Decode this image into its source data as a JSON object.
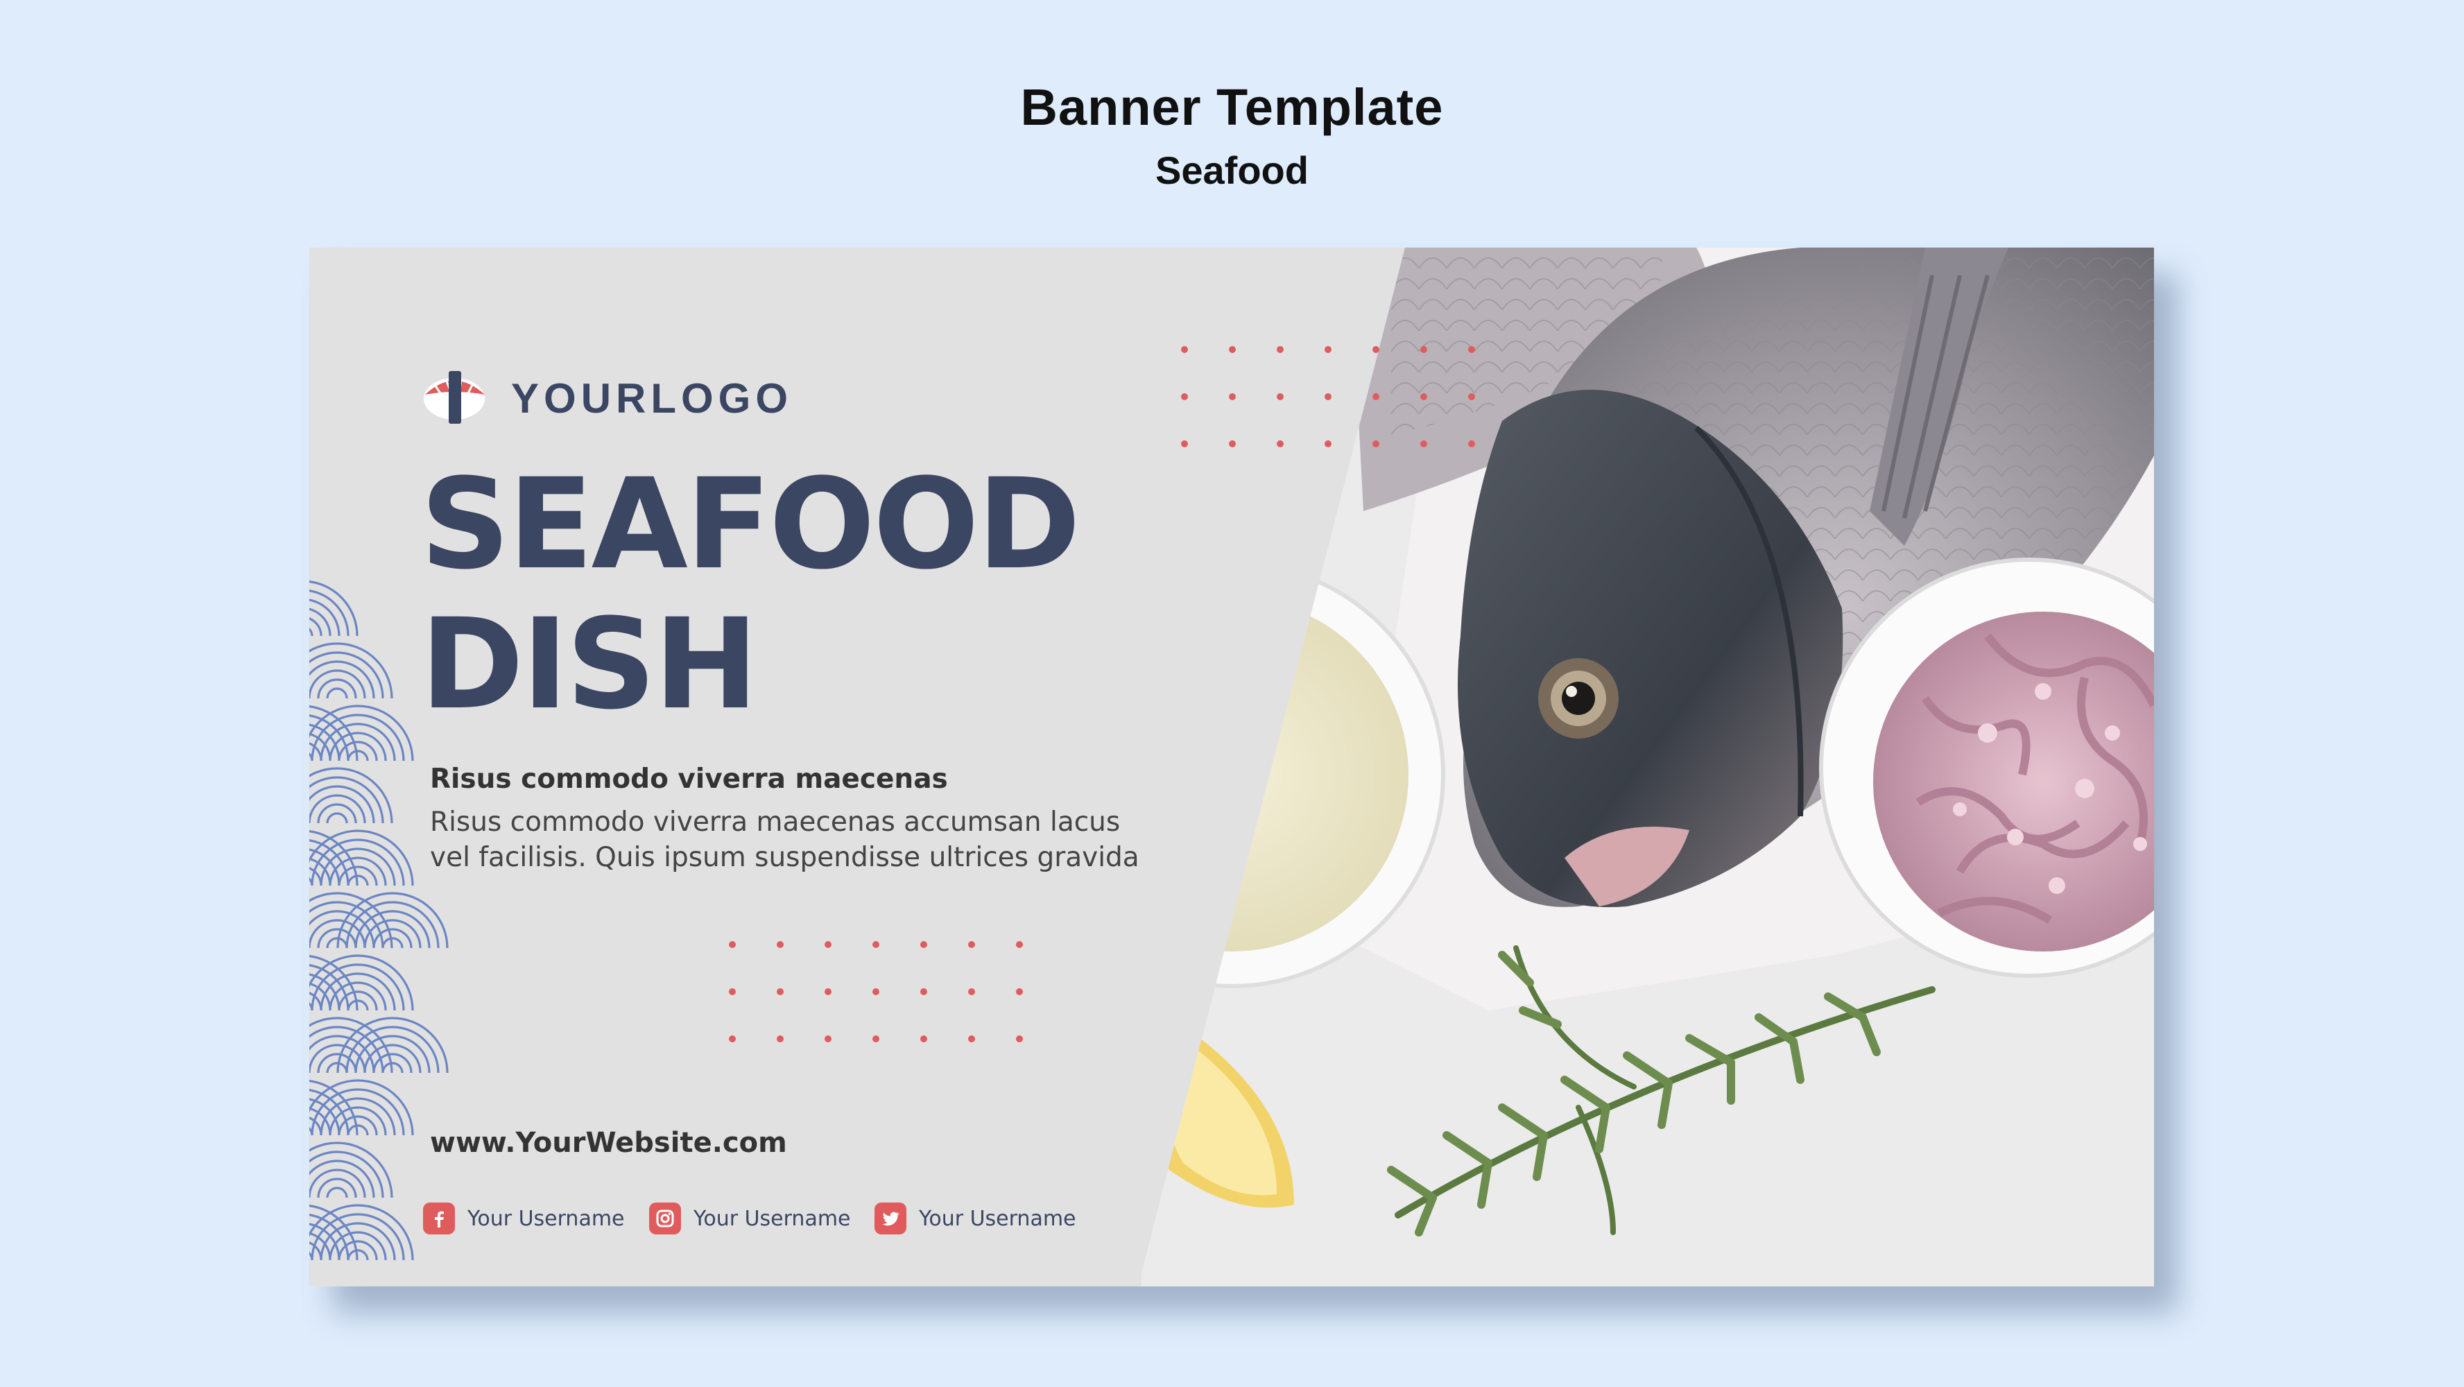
{
  "page": {
    "title": "Banner Template",
    "subtitle": "Seafood"
  },
  "banner": {
    "logo_text": "YOURLOGO",
    "headline_line1": "SEAFOOD",
    "headline_line2": "DISH",
    "subheading": "Risus commodo viverra maecenas",
    "body_line1": "Risus commodo viverra maecenas accumsan lacus",
    "body_line2": "vel facilisis. Quis ipsum suspendisse ultrices gravida",
    "website": "www.YourWebsite.com",
    "socials": [
      {
        "icon": "facebook-icon",
        "label": "Your Username"
      },
      {
        "icon": "instagram-icon",
        "label": "Your Username"
      },
      {
        "icon": "twitter-icon",
        "label": "Your Username"
      }
    ]
  },
  "colors": {
    "background": "#deecfc",
    "panel": "#e1e1e1",
    "navy": "#3b4663",
    "accent_red": "#e05c5c",
    "wave_blue": "#6b86c4"
  }
}
